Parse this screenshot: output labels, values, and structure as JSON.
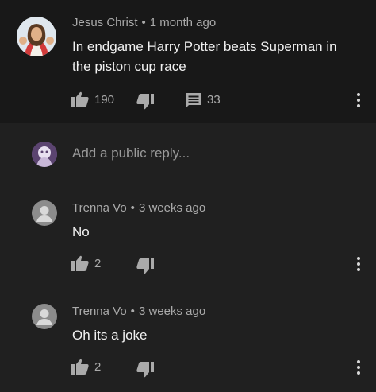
{
  "comment": {
    "author": "Jesus Christ",
    "separator": "•",
    "time": "1 month ago",
    "text": "In endgame Harry Potter beats Superman in the piston cup race",
    "likes": "190",
    "replies": "33"
  },
  "reply_box": {
    "placeholder": "Add a public reply..."
  },
  "replies": [
    {
      "author": "Trenna Vo",
      "separator": "•",
      "time": "3 weeks ago",
      "text": "No",
      "likes": "2"
    },
    {
      "author": "Trenna Vo",
      "separator": "•",
      "time": "3 weeks ago",
      "text": "Oh its a joke",
      "likes": "2"
    }
  ],
  "colors": {
    "background": "#181818",
    "reply_background": "#202020",
    "muted_text": "#aaaaaa",
    "text": "#f1f1f1"
  },
  "icons": [
    "thumbs-up-icon",
    "thumbs-down-icon",
    "reply-icon",
    "more-vert-icon",
    "default-avatar-icon"
  ]
}
